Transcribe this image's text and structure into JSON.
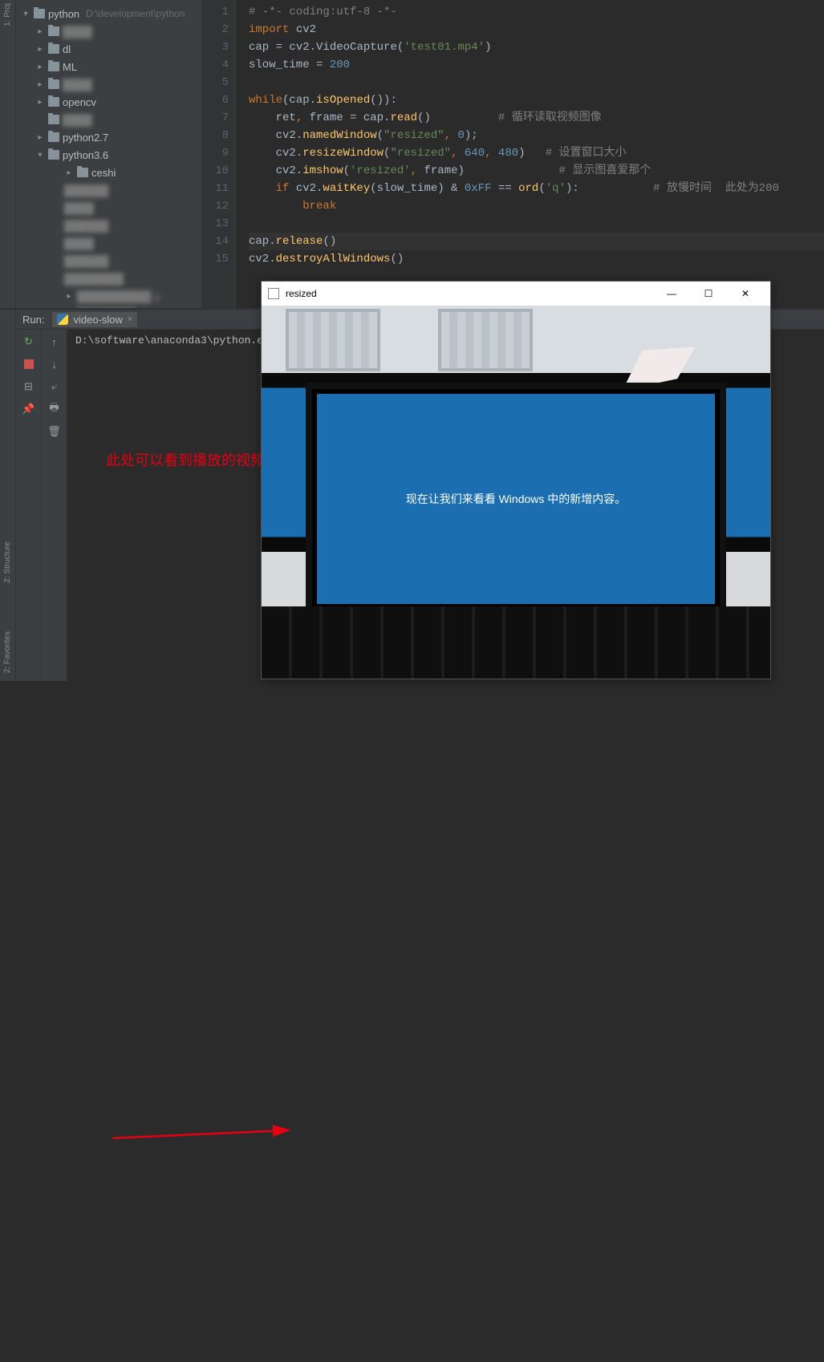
{
  "project": {
    "root_label": "python",
    "root_path": "D:\\development\\python",
    "items": [
      {
        "label": "dl",
        "expandable": true
      },
      {
        "label": "ML",
        "expandable": true
      },
      {
        "label": "opencv",
        "expandable": true
      },
      {
        "label": "python2.7",
        "expandable": true
      },
      {
        "label": "python3.6",
        "expandable": true,
        "expanded": true
      },
      {
        "label": "ceshi",
        "indent": 3,
        "expandable": true
      }
    ]
  },
  "editor": {
    "line_numbers": [
      "1",
      "2",
      "3",
      "4",
      "5",
      "6",
      "7",
      "8",
      "9",
      "10",
      "11",
      "12",
      "13",
      "14",
      "15"
    ],
    "lines": [
      {
        "tokens": [
          {
            "t": "# -*- coding:utf-8 -*-",
            "c": "c-comment"
          }
        ]
      },
      {
        "tokens": [
          {
            "t": "import ",
            "c": "c-kw"
          },
          {
            "t": "cv2",
            "c": "c-id"
          }
        ]
      },
      {
        "tokens": [
          {
            "t": "cap ",
            "c": "c-id"
          },
          {
            "t": "= ",
            "c": "c-id"
          },
          {
            "t": "cv2.",
            "c": "c-id"
          },
          {
            "t": "VideoCapture",
            "c": "c-id"
          },
          {
            "t": "(",
            "c": "c-id"
          },
          {
            "t": "'test01.mp4'",
            "c": "c-str"
          },
          {
            "t": ")",
            "c": "c-id"
          }
        ]
      },
      {
        "tokens": [
          {
            "t": "slow_time ",
            "c": "c-id"
          },
          {
            "t": "= ",
            "c": "c-id"
          },
          {
            "t": "200",
            "c": "c-num"
          }
        ]
      },
      {
        "tokens": [
          {
            "t": "",
            "c": "c-id"
          }
        ]
      },
      {
        "tokens": [
          {
            "t": "while",
            "c": "c-kw"
          },
          {
            "t": "(cap.",
            "c": "c-id"
          },
          {
            "t": "isOpened",
            "c": "c-fn"
          },
          {
            "t": "()):",
            "c": "c-id"
          }
        ]
      },
      {
        "tokens": [
          {
            "t": "    ret",
            "c": "c-id"
          },
          {
            "t": ", ",
            "c": "c-kw"
          },
          {
            "t": "frame = cap.",
            "c": "c-id"
          },
          {
            "t": "read",
            "c": "c-fn"
          },
          {
            "t": "()",
            "c": "c-id"
          },
          {
            "t": "          # 循环读取视频图像",
            "c": "c-comment"
          }
        ]
      },
      {
        "tokens": [
          {
            "t": "    cv2.",
            "c": "c-id"
          },
          {
            "t": "namedWindow",
            "c": "c-fn"
          },
          {
            "t": "(",
            "c": "c-id"
          },
          {
            "t": "\"resized\"",
            "c": "c-str"
          },
          {
            "t": ", ",
            "c": "c-kw"
          },
          {
            "t": "0",
            "c": "c-num"
          },
          {
            "t": ");",
            "c": "c-id"
          }
        ]
      },
      {
        "tokens": [
          {
            "t": "    cv2.",
            "c": "c-id"
          },
          {
            "t": "resizeWindow",
            "c": "c-fn"
          },
          {
            "t": "(",
            "c": "c-id"
          },
          {
            "t": "\"resized\"",
            "c": "c-str"
          },
          {
            "t": ", ",
            "c": "c-kw"
          },
          {
            "t": "640",
            "c": "c-num"
          },
          {
            "t": ", ",
            "c": "c-kw"
          },
          {
            "t": "480",
            "c": "c-num"
          },
          {
            "t": ")",
            "c": "c-id"
          },
          {
            "t": "   # 设置窗口大小",
            "c": "c-comment"
          }
        ]
      },
      {
        "tokens": [
          {
            "t": "    cv2.",
            "c": "c-id"
          },
          {
            "t": "imshow",
            "c": "c-fn"
          },
          {
            "t": "(",
            "c": "c-id"
          },
          {
            "t": "'resized'",
            "c": "c-str"
          },
          {
            "t": ", ",
            "c": "c-kw"
          },
          {
            "t": "frame)",
            "c": "c-id"
          },
          {
            "t": "              # 显示图喜爱那个",
            "c": "c-comment"
          }
        ]
      },
      {
        "tokens": [
          {
            "t": "    if ",
            "c": "c-kw"
          },
          {
            "t": "cv2.",
            "c": "c-id"
          },
          {
            "t": "waitKey",
            "c": "c-fn"
          },
          {
            "t": "(slow_time) ",
            "c": "c-id"
          },
          {
            "t": "& ",
            "c": "c-id"
          },
          {
            "t": "0xFF ",
            "c": "c-num"
          },
          {
            "t": "== ",
            "c": "c-id"
          },
          {
            "t": "ord",
            "c": "c-fn"
          },
          {
            "t": "(",
            "c": "c-id"
          },
          {
            "t": "'q'",
            "c": "c-str"
          },
          {
            "t": "):",
            "c": "c-id"
          },
          {
            "t": "           # 放慢时间  此处为200",
            "c": "c-comment"
          }
        ]
      },
      {
        "tokens": [
          {
            "t": "        break",
            "c": "c-kw"
          }
        ]
      },
      {
        "tokens": [
          {
            "t": "",
            "c": "c-id"
          }
        ]
      },
      {
        "tokens": [
          {
            "t": "cap.",
            "c": "c-id"
          },
          {
            "t": "release",
            "c": "c-fn"
          },
          {
            "t": "()",
            "c": "c-id"
          }
        ],
        "hl": true
      },
      {
        "tokens": [
          {
            "t": "cv2.",
            "c": "c-id"
          },
          {
            "t": "destroyAllWindows",
            "c": "c-fn"
          },
          {
            "t": "()",
            "c": "c-id"
          }
        ]
      }
    ]
  },
  "run": {
    "title": "Run:",
    "tab_label": "video-slow",
    "console_line": "D:\\software\\anaconda3\\python.e"
  },
  "sidebar_gutter": {
    "label1": "1: Proj"
  },
  "run_gutter": {
    "fav": "2: Favorites",
    "struct": "2: Structure"
  },
  "video_window": {
    "title": "resized",
    "monitor_text": "现在让我们来看看 Windows 中的新增内容。"
  },
  "annotation_text": "此处可以看到播放的视频"
}
